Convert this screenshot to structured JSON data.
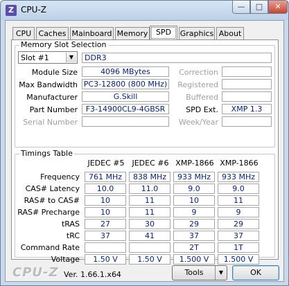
{
  "window": {
    "title": "CPU-Z",
    "icon_letter": "Z",
    "controls": {
      "minimize": "—",
      "maximize": "□",
      "close": "✕"
    }
  },
  "tabs": [
    {
      "label": "CPU",
      "active": false
    },
    {
      "label": "Caches",
      "active": false
    },
    {
      "label": "Mainboard",
      "active": false
    },
    {
      "label": "Memory",
      "active": false
    },
    {
      "label": "SPD",
      "active": true
    },
    {
      "label": "Graphics",
      "active": false
    },
    {
      "label": "About",
      "active": false
    }
  ],
  "slot": {
    "group_title": "Memory Slot Selection",
    "selected": "Slot #1",
    "type": "DDR3",
    "module_size_label": "Module Size",
    "module_size": "4096 MBytes",
    "max_bandwidth_label": "Max Bandwidth",
    "max_bandwidth": "PC3-12800 (800 MHz)",
    "manufacturer_label": "Manufacturer",
    "manufacturer": "G.Skill",
    "part_number_label": "Part Number",
    "part_number": "F3-14900CL9-4GBSR",
    "serial_number_label": "Serial Number",
    "serial_number": "",
    "correction_label": "Correction",
    "correction": "",
    "registered_label": "Registered",
    "registered": "",
    "buffered_label": "Buffered",
    "buffered": "",
    "spd_ext_label": "SPD Ext.",
    "spd_ext": "XMP 1.3",
    "week_year_label": "Week/Year",
    "week_year": ""
  },
  "timings": {
    "group_title": "Timings Table",
    "columns": [
      "JEDEC #5",
      "JEDEC #6",
      "XMP-1866",
      "XMP-1866"
    ],
    "rows": [
      {
        "label": "Frequency",
        "values": [
          "761 MHz",
          "838 MHz",
          "933 MHz",
          "933 MHz"
        ]
      },
      {
        "label": "CAS# Latency",
        "values": [
          "10.0",
          "11.0",
          "9.0",
          "9.0"
        ]
      },
      {
        "label": "RAS# to CAS#",
        "values": [
          "10",
          "11",
          "10",
          "11"
        ]
      },
      {
        "label": "RAS# Precharge",
        "values": [
          "10",
          "11",
          "9",
          "9"
        ]
      },
      {
        "label": "tRAS",
        "values": [
          "27",
          "30",
          "29",
          "29"
        ]
      },
      {
        "label": "tRC",
        "values": [
          "37",
          "41",
          "37",
          "37"
        ]
      },
      {
        "label": "Command Rate",
        "values": [
          "",
          "",
          "2T",
          "1T"
        ]
      },
      {
        "label": "Voltage",
        "values": [
          "1.50 V",
          "1.50 V",
          "1.500 V",
          "1.500 V"
        ]
      }
    ]
  },
  "footer": {
    "logo": "CPU-Z",
    "version": "Ver. 1.66.1.x64",
    "tools_label": "Tools",
    "ok_label": "OK"
  }
}
